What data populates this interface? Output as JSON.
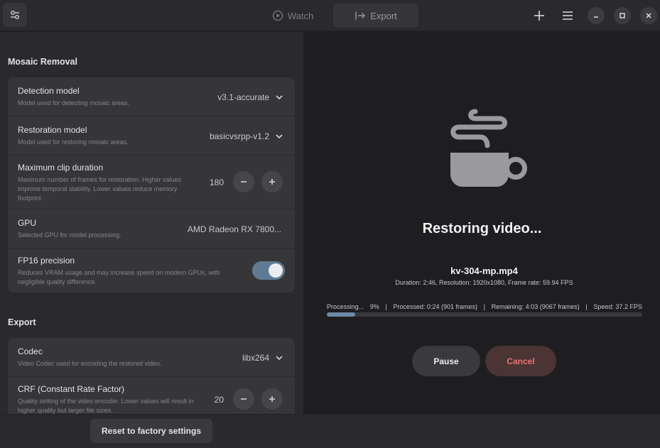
{
  "titlebar": {
    "tabs": [
      {
        "label": "Watch",
        "icon": "play-circle-icon",
        "active": false
      },
      {
        "label": "Export",
        "icon": "export-arrow-icon",
        "active": true
      }
    ]
  },
  "sidebar": {
    "mosaic_section_title": "Mosaic Removal",
    "detection": {
      "title": "Detection model",
      "subtitle": "Model used for detecting mosaic areas.",
      "value": "v3.1-accurate"
    },
    "restoration": {
      "title": "Restoration model",
      "subtitle": "Model used for restoring mosaic areas.",
      "value": "basicvsrpp-v1.2"
    },
    "max_clip": {
      "title": "Maximum clip duration",
      "subtitle": "Maximum number of frames for restoration. Higher values improve temporal stability. Lower values reduce memory footprint.",
      "value": "180"
    },
    "gpu": {
      "title": "GPU",
      "subtitle": "Selected GPU for model processing.",
      "value": "AMD Radeon RX 7800..."
    },
    "fp16": {
      "title": "FP16 precision",
      "subtitle": "Reduces VRAM usage and may increase speed on modern GPUs, with negligible quality difference.",
      "enabled": true
    },
    "export_section_title": "Export",
    "codec": {
      "title": "Codec",
      "subtitle": "Video Codec used for encoding the restored video.",
      "value": "libx264"
    },
    "crf": {
      "title": "CRF (Constant Rate Factor)",
      "subtitle": "Quality setting of the video encoder. Lower values will result in higher quality but larger file sizes.",
      "value": "20"
    }
  },
  "footer": {
    "reset_label": "Reset to factory settings"
  },
  "main": {
    "status_title": "Restoring video...",
    "file_name": "kv-304-mp.mp4",
    "file_meta": "Duration: 2:46, Resolution: 1920x1080, Frame rate: 59.94 FPS",
    "progress": {
      "label": "Processing...",
      "percent_text": "9%",
      "processed": "Processed: 0:24 (901 frames)",
      "remaining": "Remaining: 4:03 (9067 frames)",
      "speed": "Speed: 37.2 FPS",
      "fraction": 0.09
    },
    "pause_label": "Pause",
    "cancel_label": "Cancel"
  },
  "colors": {
    "accent": "#6d8aa6",
    "cancel_text": "#f07070",
    "toggle_on": "#5f7b94"
  }
}
